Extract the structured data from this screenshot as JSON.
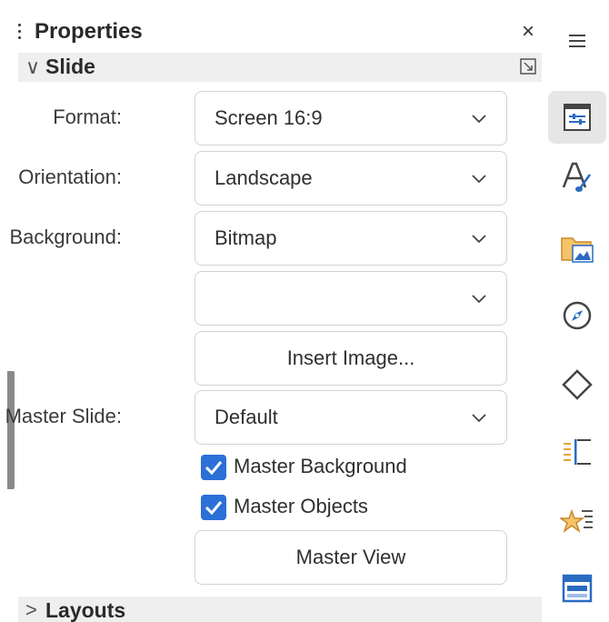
{
  "panel": {
    "title": "Properties",
    "close_glyph": "×",
    "section": {
      "name": "Slide",
      "expanded_glyph": "∨"
    },
    "format": {
      "label": "Format:",
      "value": "Screen 16:9"
    },
    "orientation": {
      "label": "Orientation:",
      "value": "Landscape"
    },
    "background": {
      "label": "Background:",
      "value": "Bitmap",
      "sub_value": ""
    },
    "insert_image_label": "Insert Image...",
    "master_slide": {
      "label": "Master Slide:",
      "value": "Default"
    },
    "master_background": {
      "label": "Master Background",
      "checked": true
    },
    "master_objects": {
      "label": "Master Objects",
      "checked": true
    },
    "master_view_label": "Master View",
    "layouts_section": {
      "name": "Layouts",
      "collapsed_glyph": ">"
    }
  },
  "tabbar": {
    "items": [
      {
        "icon": "hamburger-menu-icon"
      },
      {
        "icon": "properties-icon",
        "active": true
      },
      {
        "icon": "styles-icon"
      },
      {
        "icon": "gallery-icon"
      },
      {
        "icon": "navigator-icon"
      },
      {
        "icon": "shapes-icon"
      },
      {
        "icon": "slide-transition-icon"
      },
      {
        "icon": "animation-icon"
      },
      {
        "icon": "master-slides-icon"
      }
    ]
  },
  "colors": {
    "accent": "#2c6fd6",
    "header_bg": "#efefef",
    "orange_icon": "#e8a33c",
    "blue_icon": "#2a6bc2"
  }
}
